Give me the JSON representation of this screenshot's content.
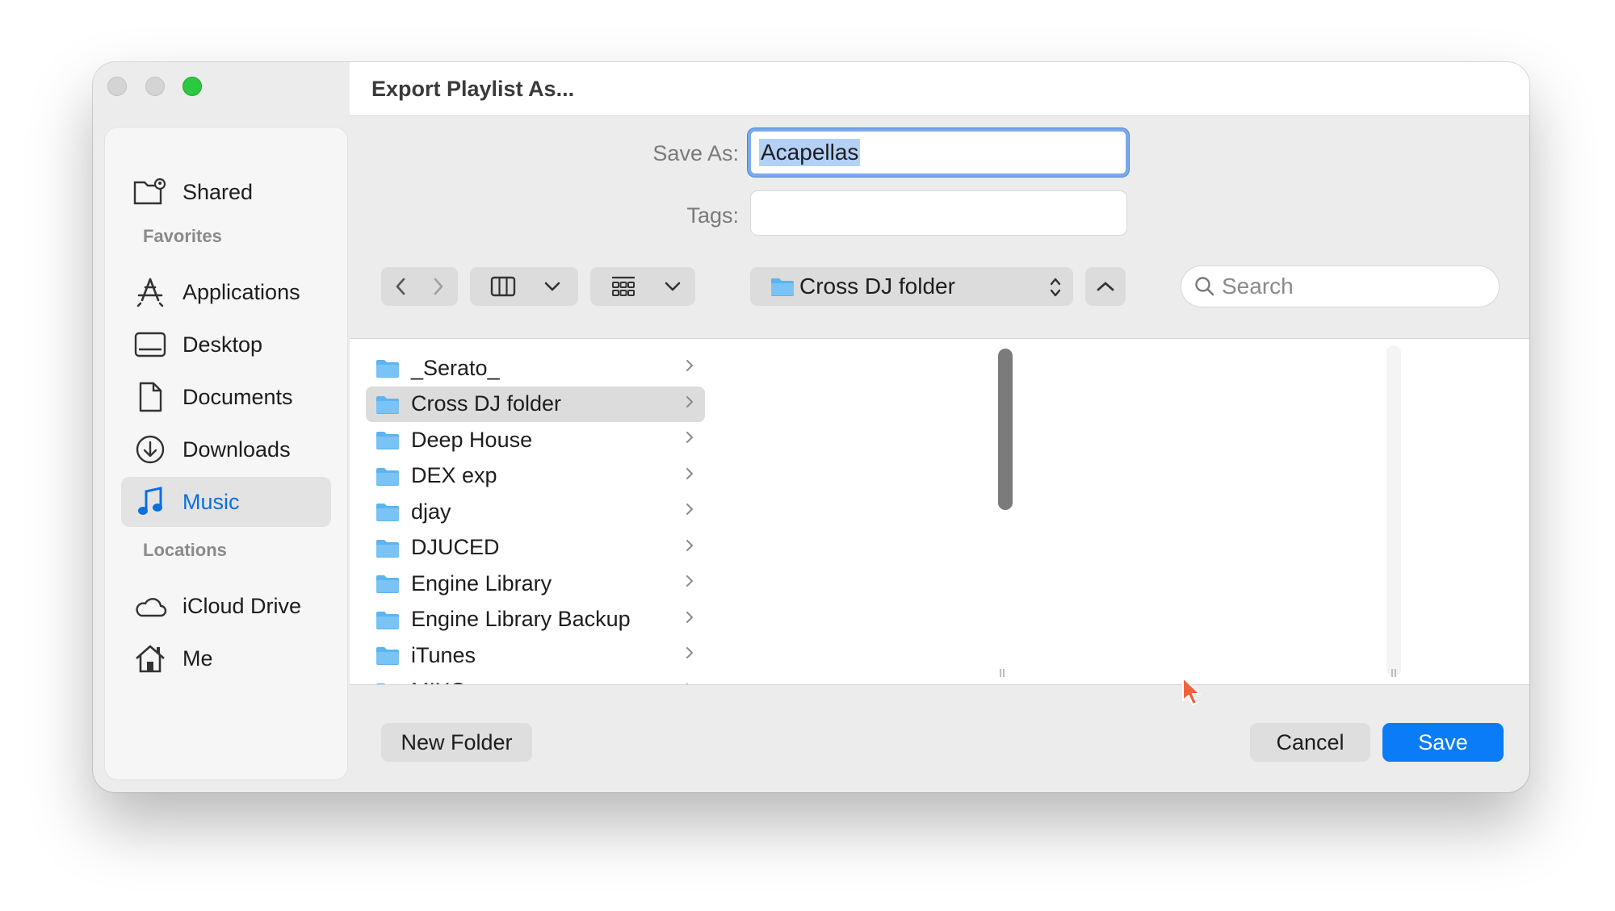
{
  "window": {
    "title": "Export Playlist As..."
  },
  "sidebar": {
    "shared": "Shared",
    "favorites_header": "Favorites",
    "favorites": [
      "Applications",
      "Desktop",
      "Documents",
      "Downloads",
      "Music"
    ],
    "locations_header": "Locations",
    "locations": [
      "iCloud Drive",
      "Me"
    ]
  },
  "form": {
    "save_as_label": "Save As:",
    "save_as_value": "Acapellas",
    "tags_label": "Tags:",
    "tags_value": ""
  },
  "toolbar": {
    "location": "Cross DJ folder",
    "search_placeholder": "Search"
  },
  "files": [
    "_Serato_",
    "Cross DJ folder",
    "Deep House",
    "DEX exp",
    "djay",
    "DJUCED",
    "Engine Library",
    "Engine Library Backup",
    "iTunes",
    "MIXO"
  ],
  "selected_file": "Cross DJ folder",
  "footer": {
    "new_folder": "New Folder",
    "cancel": "Cancel",
    "save": "Save"
  },
  "colors": {
    "accent": "#0a7cf7",
    "folder": "#5cb4f0",
    "sidebar_active_text": "#0a6fe0"
  }
}
